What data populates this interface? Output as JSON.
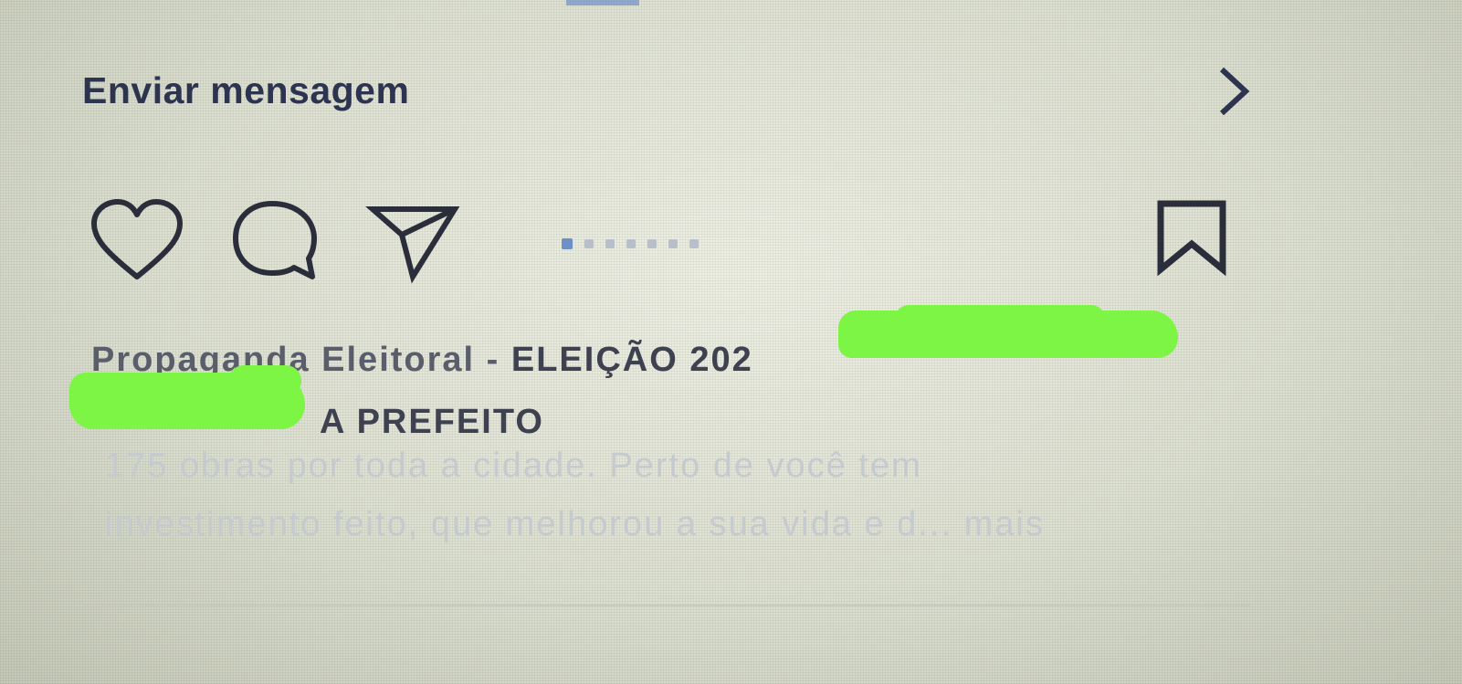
{
  "message_row": {
    "label": "Enviar mensagem",
    "chevron_icon": "chevron-right-icon"
  },
  "actions": {
    "like_icon": "heart-icon",
    "comment_icon": "comment-icon",
    "share_icon": "paper-plane-icon",
    "save_icon": "bookmark-icon"
  },
  "carousel": {
    "total_dots": 7,
    "active_index": 0,
    "active_color": "#6f8fc9"
  },
  "caption": {
    "line1_prefix": "Propaganda Eleitoral - ",
    "line1_main": "ELEIÇÃO 202",
    "line2": "A PREFEITO",
    "description_line1": "175 obras por toda a cidade. Perto de você tem",
    "description_line2": "investimento feito, que melhorou a sua vida e d... mais"
  },
  "colors": {
    "text_dark": "#2d3450",
    "redaction": "#7cf545"
  }
}
